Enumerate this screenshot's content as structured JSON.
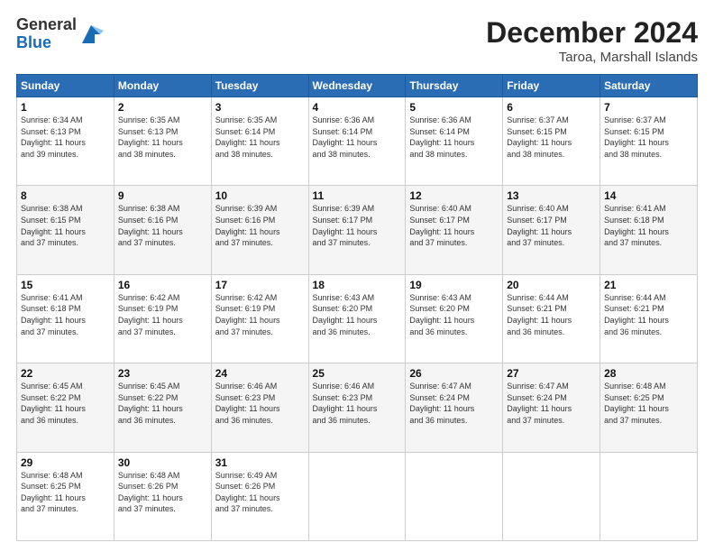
{
  "header": {
    "logo_line1": "General",
    "logo_line2": "Blue",
    "month_title": "December 2024",
    "location": "Taroa, Marshall Islands"
  },
  "days_of_week": [
    "Sunday",
    "Monday",
    "Tuesday",
    "Wednesday",
    "Thursday",
    "Friday",
    "Saturday"
  ],
  "weeks": [
    [
      {
        "day": "1",
        "info": "Sunrise: 6:34 AM\nSunset: 6:13 PM\nDaylight: 11 hours\nand 39 minutes."
      },
      {
        "day": "2",
        "info": "Sunrise: 6:35 AM\nSunset: 6:13 PM\nDaylight: 11 hours\nand 38 minutes."
      },
      {
        "day": "3",
        "info": "Sunrise: 6:35 AM\nSunset: 6:14 PM\nDaylight: 11 hours\nand 38 minutes."
      },
      {
        "day": "4",
        "info": "Sunrise: 6:36 AM\nSunset: 6:14 PM\nDaylight: 11 hours\nand 38 minutes."
      },
      {
        "day": "5",
        "info": "Sunrise: 6:36 AM\nSunset: 6:14 PM\nDaylight: 11 hours\nand 38 minutes."
      },
      {
        "day": "6",
        "info": "Sunrise: 6:37 AM\nSunset: 6:15 PM\nDaylight: 11 hours\nand 38 minutes."
      },
      {
        "day": "7",
        "info": "Sunrise: 6:37 AM\nSunset: 6:15 PM\nDaylight: 11 hours\nand 38 minutes."
      }
    ],
    [
      {
        "day": "8",
        "info": "Sunrise: 6:38 AM\nSunset: 6:15 PM\nDaylight: 11 hours\nand 37 minutes."
      },
      {
        "day": "9",
        "info": "Sunrise: 6:38 AM\nSunset: 6:16 PM\nDaylight: 11 hours\nand 37 minutes."
      },
      {
        "day": "10",
        "info": "Sunrise: 6:39 AM\nSunset: 6:16 PM\nDaylight: 11 hours\nand 37 minutes."
      },
      {
        "day": "11",
        "info": "Sunrise: 6:39 AM\nSunset: 6:17 PM\nDaylight: 11 hours\nand 37 minutes."
      },
      {
        "day": "12",
        "info": "Sunrise: 6:40 AM\nSunset: 6:17 PM\nDaylight: 11 hours\nand 37 minutes."
      },
      {
        "day": "13",
        "info": "Sunrise: 6:40 AM\nSunset: 6:17 PM\nDaylight: 11 hours\nand 37 minutes."
      },
      {
        "day": "14",
        "info": "Sunrise: 6:41 AM\nSunset: 6:18 PM\nDaylight: 11 hours\nand 37 minutes."
      }
    ],
    [
      {
        "day": "15",
        "info": "Sunrise: 6:41 AM\nSunset: 6:18 PM\nDaylight: 11 hours\nand 37 minutes."
      },
      {
        "day": "16",
        "info": "Sunrise: 6:42 AM\nSunset: 6:19 PM\nDaylight: 11 hours\nand 37 minutes."
      },
      {
        "day": "17",
        "info": "Sunrise: 6:42 AM\nSunset: 6:19 PM\nDaylight: 11 hours\nand 37 minutes."
      },
      {
        "day": "18",
        "info": "Sunrise: 6:43 AM\nSunset: 6:20 PM\nDaylight: 11 hours\nand 36 minutes."
      },
      {
        "day": "19",
        "info": "Sunrise: 6:43 AM\nSunset: 6:20 PM\nDaylight: 11 hours\nand 36 minutes."
      },
      {
        "day": "20",
        "info": "Sunrise: 6:44 AM\nSunset: 6:21 PM\nDaylight: 11 hours\nand 36 minutes."
      },
      {
        "day": "21",
        "info": "Sunrise: 6:44 AM\nSunset: 6:21 PM\nDaylight: 11 hours\nand 36 minutes."
      }
    ],
    [
      {
        "day": "22",
        "info": "Sunrise: 6:45 AM\nSunset: 6:22 PM\nDaylight: 11 hours\nand 36 minutes."
      },
      {
        "day": "23",
        "info": "Sunrise: 6:45 AM\nSunset: 6:22 PM\nDaylight: 11 hours\nand 36 minutes."
      },
      {
        "day": "24",
        "info": "Sunrise: 6:46 AM\nSunset: 6:23 PM\nDaylight: 11 hours\nand 36 minutes."
      },
      {
        "day": "25",
        "info": "Sunrise: 6:46 AM\nSunset: 6:23 PM\nDaylight: 11 hours\nand 36 minutes."
      },
      {
        "day": "26",
        "info": "Sunrise: 6:47 AM\nSunset: 6:24 PM\nDaylight: 11 hours\nand 36 minutes."
      },
      {
        "day": "27",
        "info": "Sunrise: 6:47 AM\nSunset: 6:24 PM\nDaylight: 11 hours\nand 37 minutes."
      },
      {
        "day": "28",
        "info": "Sunrise: 6:48 AM\nSunset: 6:25 PM\nDaylight: 11 hours\nand 37 minutes."
      }
    ],
    [
      {
        "day": "29",
        "info": "Sunrise: 6:48 AM\nSunset: 6:25 PM\nDaylight: 11 hours\nand 37 minutes."
      },
      {
        "day": "30",
        "info": "Sunrise: 6:48 AM\nSunset: 6:26 PM\nDaylight: 11 hours\nand 37 minutes."
      },
      {
        "day": "31",
        "info": "Sunrise: 6:49 AM\nSunset: 6:26 PM\nDaylight: 11 hours\nand 37 minutes."
      },
      null,
      null,
      null,
      null
    ]
  ]
}
